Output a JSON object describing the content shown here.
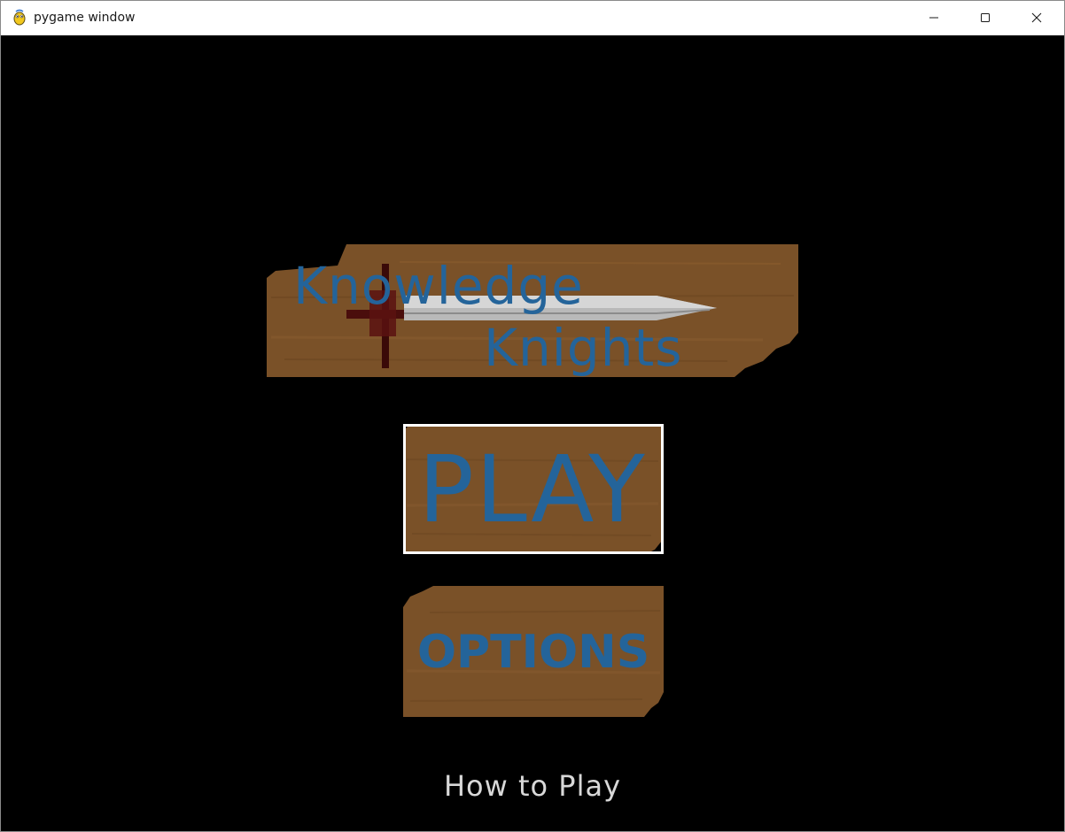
{
  "window": {
    "title": "pygame window",
    "controls": {
      "minimize_icon": "minimize-icon",
      "maximize_icon": "maximize-icon",
      "close_icon": "close-icon"
    }
  },
  "game": {
    "background_color": "#000000",
    "logo": {
      "line1": "Knowledge",
      "line2": "Knights",
      "text_color": "#24649a",
      "plank_color": "#7a5128",
      "icon": "sword-icon"
    },
    "menu": {
      "play_label": "PLAY",
      "options_label": "OPTIONS",
      "how_to_play_label": "How to Play",
      "selected_item": "PLAY"
    }
  }
}
